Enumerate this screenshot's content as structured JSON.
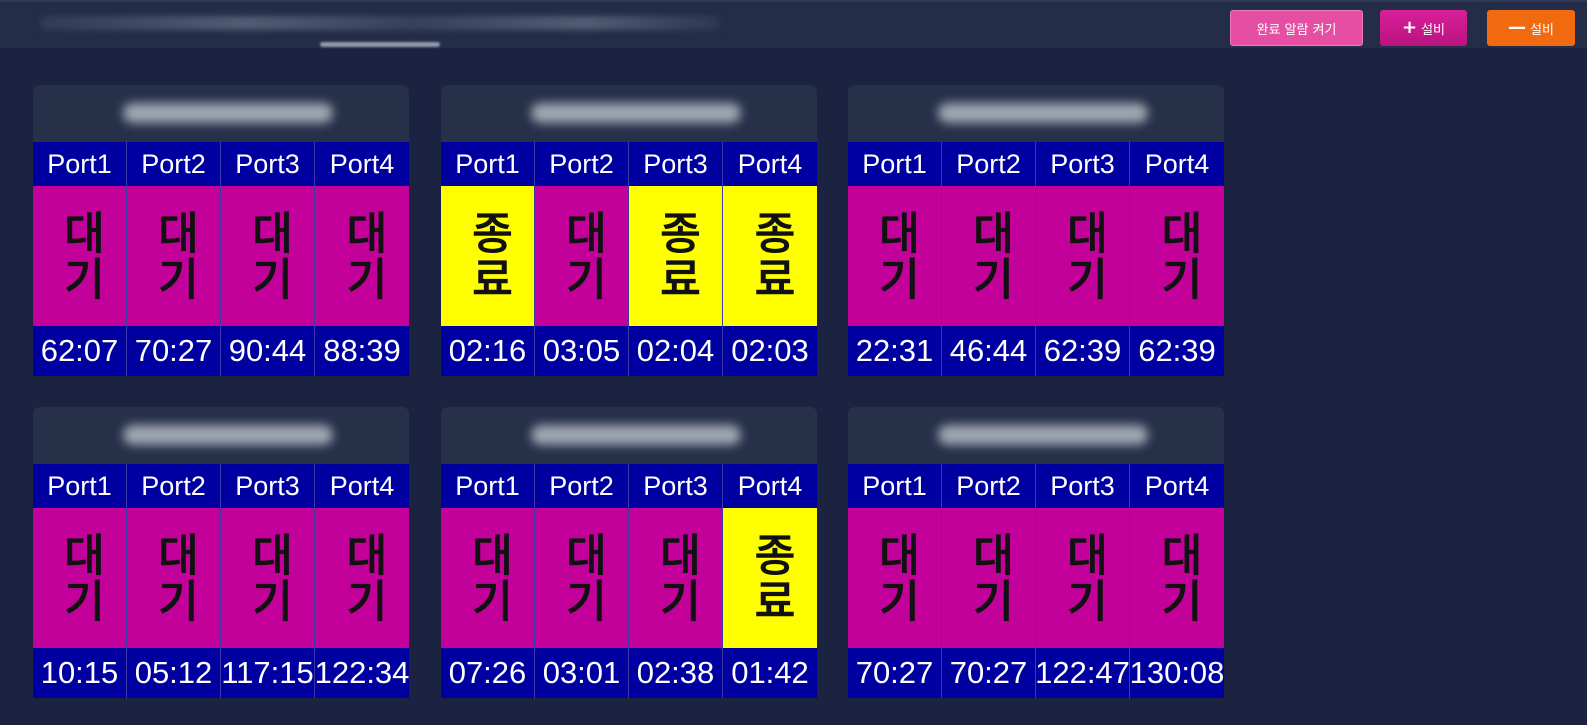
{
  "header": {
    "buttons": {
      "alarm_label": "완료 알람 켜기",
      "add_label": "설비",
      "add_symbol": "+",
      "remove_label": "설비",
      "remove_symbol": "—"
    }
  },
  "colors": {
    "waiting": "#c4009b",
    "done": "#ffff00",
    "port_bg": "#0000a0"
  },
  "cards": [
    {
      "ports": [
        {
          "name": "Port1",
          "status": "대기",
          "state": "waiting",
          "time": "62:07"
        },
        {
          "name": "Port2",
          "status": "대기",
          "state": "waiting",
          "time": "70:27"
        },
        {
          "name": "Port3",
          "status": "대기",
          "state": "waiting",
          "time": "90:44"
        },
        {
          "name": "Port4",
          "status": "대기",
          "state": "waiting",
          "time": "88:39"
        }
      ]
    },
    {
      "ports": [
        {
          "name": "Port1",
          "status": "종료",
          "state": "done",
          "time": "02:16"
        },
        {
          "name": "Port2",
          "status": "대기",
          "state": "waiting",
          "time": "03:05"
        },
        {
          "name": "Port3",
          "status": "종료",
          "state": "done",
          "time": "02:04"
        },
        {
          "name": "Port4",
          "status": "종료",
          "state": "done",
          "time": "02:03"
        }
      ]
    },
    {
      "ports": [
        {
          "name": "Port1",
          "status": "대기",
          "state": "waiting",
          "time": "22:31"
        },
        {
          "name": "Port2",
          "status": "대기",
          "state": "waiting",
          "time": "46:44"
        },
        {
          "name": "Port3",
          "status": "대기",
          "state": "waiting",
          "time": "62:39"
        },
        {
          "name": "Port4",
          "status": "대기",
          "state": "waiting",
          "time": "62:39"
        }
      ]
    },
    {
      "ports": [
        {
          "name": "Port1",
          "status": "대기",
          "state": "waiting",
          "time": "10:15"
        },
        {
          "name": "Port2",
          "status": "대기",
          "state": "waiting",
          "time": "05:12"
        },
        {
          "name": "Port3",
          "status": "대기",
          "state": "waiting",
          "time": "117:15"
        },
        {
          "name": "Port4",
          "status": "대기",
          "state": "waiting",
          "time": "122:34"
        }
      ]
    },
    {
      "ports": [
        {
          "name": "Port1",
          "status": "대기",
          "state": "waiting",
          "time": "07:26"
        },
        {
          "name": "Port2",
          "status": "대기",
          "state": "waiting",
          "time": "03:01"
        },
        {
          "name": "Port3",
          "status": "대기",
          "state": "waiting",
          "time": "02:38"
        },
        {
          "name": "Port4",
          "status": "종료",
          "state": "done",
          "time": "01:42"
        }
      ]
    },
    {
      "ports": [
        {
          "name": "Port1",
          "status": "대기",
          "state": "waiting",
          "time": "70:27"
        },
        {
          "name": "Port2",
          "status": "대기",
          "state": "waiting",
          "time": "70:27"
        },
        {
          "name": "Port3",
          "status": "대기",
          "state": "waiting",
          "time": "122:47"
        },
        {
          "name": "Port4",
          "status": "대기",
          "state": "waiting",
          "time": "130:08"
        }
      ]
    }
  ]
}
